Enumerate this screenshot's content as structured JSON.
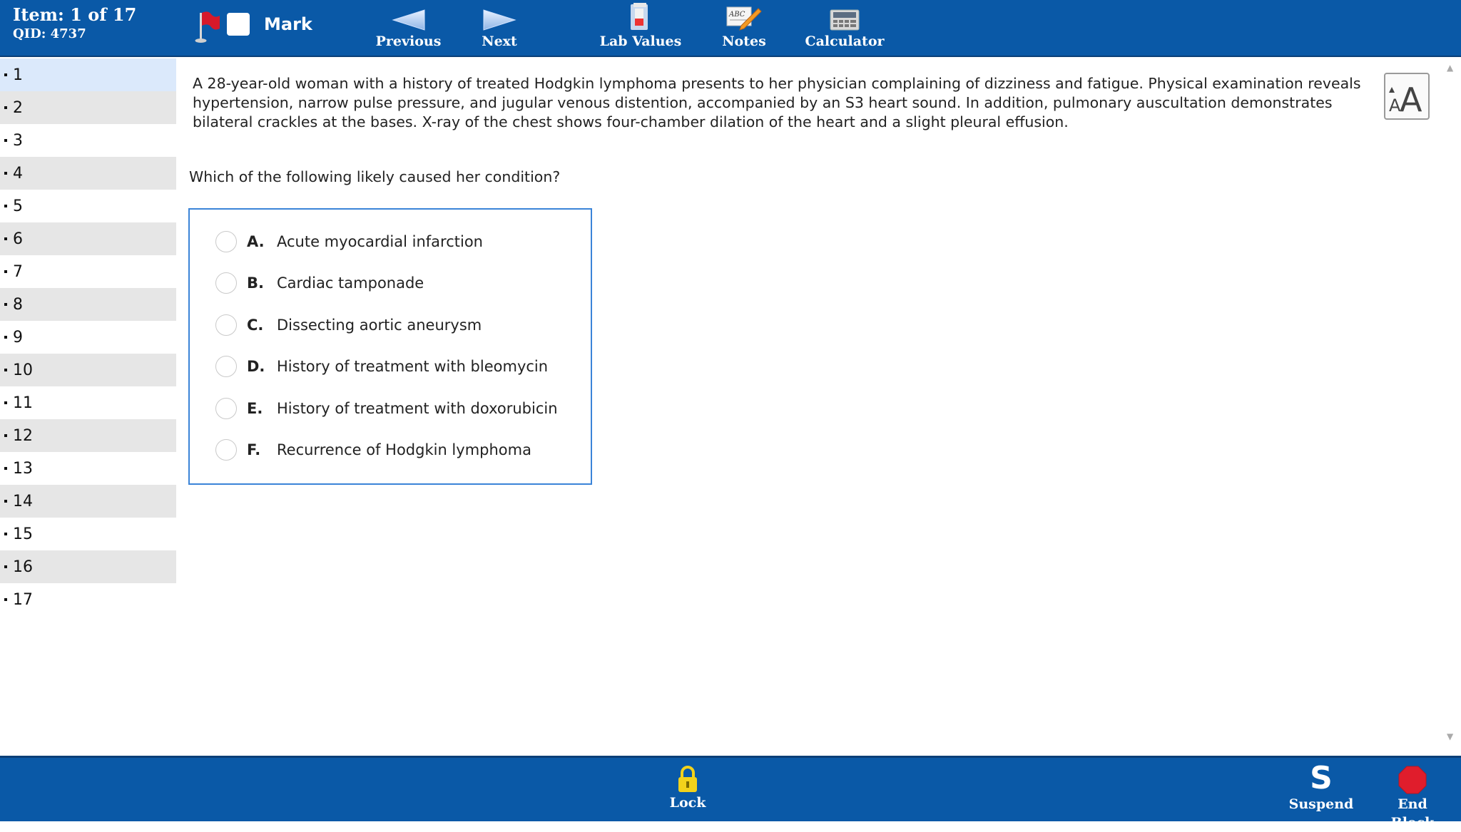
{
  "header": {
    "item_label": "Item: 1 of 17",
    "qid_label": "QID: 4737",
    "mark_label": "Mark",
    "tools": {
      "previous": "Previous",
      "next": "Next",
      "lab_values": "Lab Values",
      "notes": "Notes",
      "notes_icon_text": "ABC",
      "calculator": "Calculator"
    }
  },
  "sidebar": {
    "items": [
      "1",
      "2",
      "3",
      "4",
      "5",
      "6",
      "7",
      "8",
      "9",
      "10",
      "11",
      "12",
      "13",
      "14",
      "15",
      "16",
      "17"
    ],
    "active_item": "1"
  },
  "question": {
    "stem": "A 28-year-old woman with a history of treated Hodgkin lymphoma presents to her physician complaining of dizziness and fatigue. Physical examination reveals hypertension, narrow pulse pressure, and jugular venous distention, accompanied by an S3 heart sound. In addition, pulmonary auscultation demonstrates bilateral crackles at the bases. X-ray of the chest shows four-chamber dilation of the heart and a slight pleural effusion.",
    "prompt": "Which of the following likely caused her condition?",
    "options": [
      {
        "letter": "A.",
        "text": "Acute myocardial infarction"
      },
      {
        "letter": "B.",
        "text": "Cardiac tamponade"
      },
      {
        "letter": "C.",
        "text": "Dissecting aortic aneurysm"
      },
      {
        "letter": "D.",
        "text": "History of treatment with bleomycin"
      },
      {
        "letter": "E.",
        "text": "History of treatment with doxorubicin"
      },
      {
        "letter": "F.",
        "text": "Recurrence of Hodgkin lymphoma"
      }
    ]
  },
  "footer": {
    "lock": "Lock",
    "suspend": "Suspend",
    "suspend_icon_letter": "S",
    "end_block": "End Block"
  },
  "colors": {
    "toolbar": "#0a59a7",
    "active_nav": "#dbe9fb",
    "shaded_nav": "#e6e6e6",
    "answer_border": "#3b84d8",
    "end_block_icon": "#e01d2c",
    "flag": "#d7192a"
  },
  "icons": {
    "flag": "flag-icon",
    "previous": "left-arrow-icon",
    "next": "right-arrow-icon",
    "lab_values": "flask-icon",
    "notes": "notepad-pencil-icon",
    "calculator": "calculator-icon",
    "font_size": "font-size-icon",
    "lock": "padlock-icon",
    "suspend": "suspend-icon",
    "end_block": "stop-sign-icon"
  }
}
